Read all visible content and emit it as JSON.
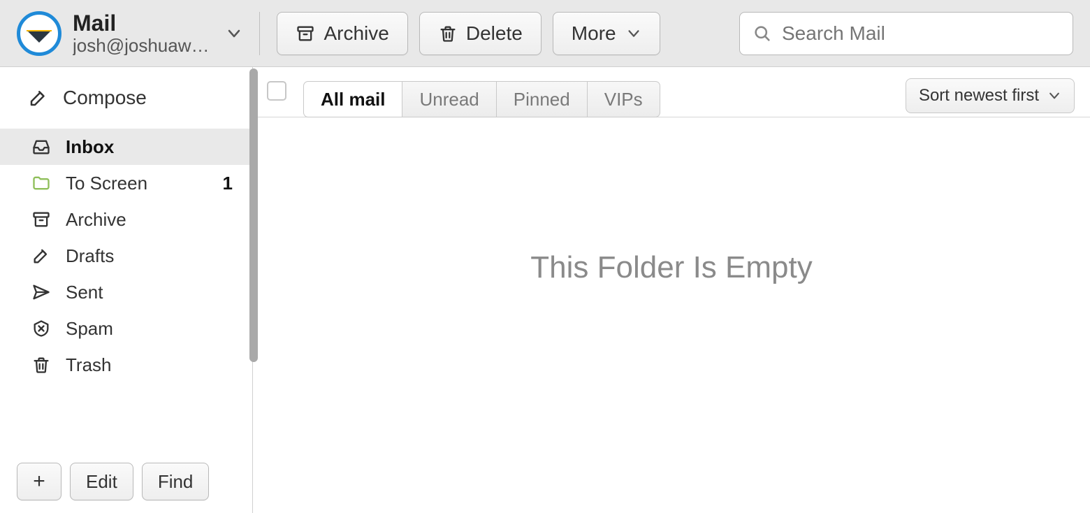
{
  "header": {
    "app_title": "Mail",
    "account_email": "josh@joshuaw…",
    "archive_label": "Archive",
    "delete_label": "Delete",
    "more_label": "More",
    "search_placeholder": "Search Mail"
  },
  "sidebar": {
    "compose_label": "Compose",
    "items": [
      {
        "label": "Inbox",
        "badge": "",
        "selected": true
      },
      {
        "label": "To Screen",
        "badge": "1",
        "selected": false,
        "folder": true
      },
      {
        "label": "Archive",
        "badge": "",
        "selected": false
      },
      {
        "label": "Drafts",
        "badge": "",
        "selected": false
      },
      {
        "label": "Sent",
        "badge": "",
        "selected": false
      },
      {
        "label": "Spam",
        "badge": "",
        "selected": false
      },
      {
        "label": "Trash",
        "badge": "",
        "selected": false
      }
    ],
    "footer": {
      "add_label": "+",
      "edit_label": "Edit",
      "find_label": "Find"
    }
  },
  "content": {
    "tabs": [
      {
        "label": "All mail",
        "active": true
      },
      {
        "label": "Unread",
        "active": false
      },
      {
        "label": "Pinned",
        "active": false
      },
      {
        "label": "VIPs",
        "active": false
      }
    ],
    "sort_label": "Sort newest first",
    "empty_message": "This Folder Is Empty"
  }
}
